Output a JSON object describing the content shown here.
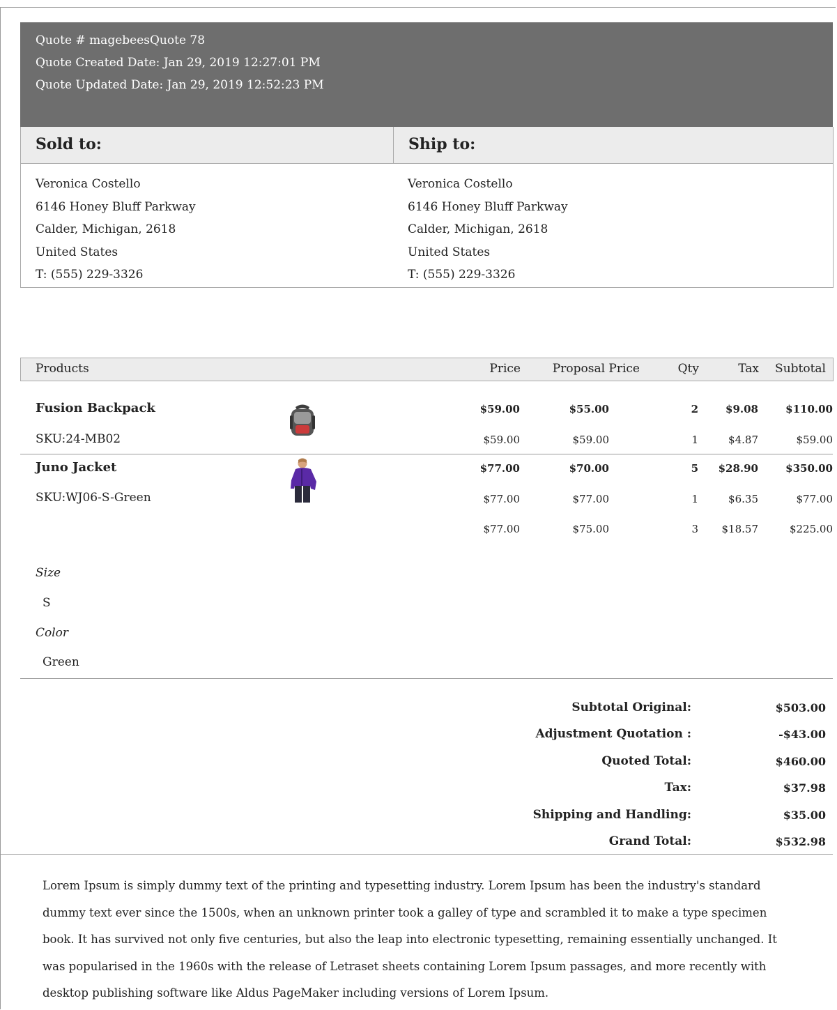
{
  "quote": {
    "number_line": "Quote # magebeesQuote 78",
    "created_line": "Quote Created Date: Jan 29, 2019 12:27:01 PM",
    "updated_line": "Quote Updated Date: Jan 29, 2019 12:52:23 PM"
  },
  "sold_to": {
    "title": "Sold to:",
    "name": "Veronica Costello",
    "street": "6146 Honey Bluff Parkway",
    "city": "Calder, Michigan, 2618",
    "country": "United States",
    "phone": "T: (555) 229-3326"
  },
  "ship_to": {
    "title": "Ship to:",
    "name": "Veronica Costello",
    "street": "6146 Honey Bluff Parkway",
    "city": "Calder, Michigan, 2618",
    "country": "United States",
    "phone": "T: (555) 229-3326"
  },
  "table": {
    "headers": {
      "products": "Products",
      "price": "Price",
      "proposal": "Proposal Price",
      "qty": "Qty",
      "tax": "Tax",
      "subtotal": "Subtotal"
    }
  },
  "items": [
    {
      "name": "Fusion Backpack",
      "sku": "SKU:24-MB02",
      "thumb_icon": "backpack-icon",
      "main": {
        "price": "$59.00",
        "proposal": "$55.00",
        "qty": "2",
        "tax": "$9.08",
        "subtotal": "$110.00"
      },
      "tiers": [
        {
          "price": "$59.00",
          "proposal": "$59.00",
          "qty": "1",
          "tax": "$4.87",
          "subtotal": "$59.00"
        }
      ]
    },
    {
      "name": "Juno Jacket",
      "sku": "SKU:WJ06-S-Green",
      "thumb_icon": "jacket-icon",
      "main": {
        "price": "$77.00",
        "proposal": "$70.00",
        "qty": "5",
        "tax": "$28.90",
        "subtotal": "$350.00"
      },
      "tiers": [
        {
          "price": "$77.00",
          "proposal": "$77.00",
          "qty": "1",
          "tax": "$6.35",
          "subtotal": "$77.00"
        },
        {
          "price": "$77.00",
          "proposal": "$75.00",
          "qty": "3",
          "tax": "$18.57",
          "subtotal": "$225.00"
        }
      ],
      "options": [
        {
          "label": "Size",
          "value": "S"
        },
        {
          "label": "Color",
          "value": "Green"
        }
      ]
    }
  ],
  "totals": [
    {
      "label": "Subtotal Original:",
      "value": "$503.00"
    },
    {
      "label": "Adjustment Quotation :",
      "value": "-$43.00"
    },
    {
      "label": "Quoted Total:",
      "value": "$460.00"
    },
    {
      "label": "Tax:",
      "value": "$37.98"
    },
    {
      "label": "Shipping and Handling:",
      "value": "$35.00"
    },
    {
      "label": "Grand Total:",
      "value": "$532.98"
    }
  ],
  "footer_text": "Lorem Ipsum is simply dummy text of the printing and typesetting industry. Lorem Ipsum has been the industry's standard dummy text ever since the 1500s, when an unknown printer took a galley of type and scrambled it to make a type specimen book. It has survived not only five centuries, but also the leap into electronic typesetting, remaining essentially unchanged. It was popularised in the 1960s with the release of Letraset sheets containing Lorem Ipsum passages, and more recently with desktop publishing software like Aldus PageMaker including versions of Lorem Ipsum."
}
